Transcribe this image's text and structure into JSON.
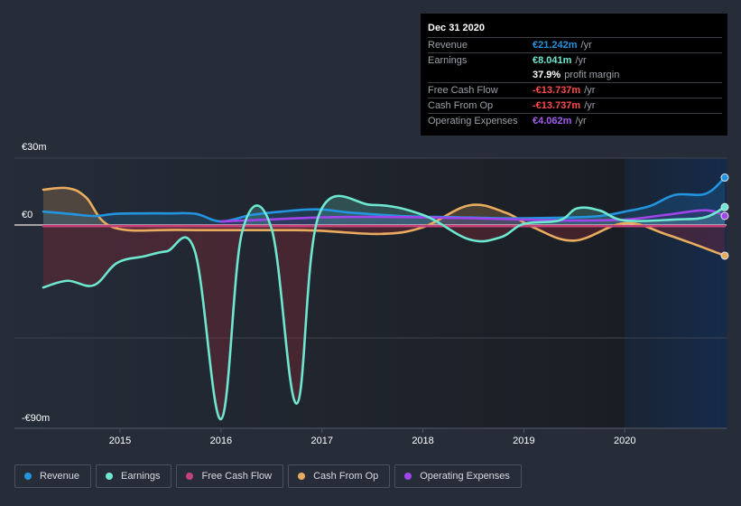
{
  "tooltip": {
    "date": "Dec 31 2020",
    "rows": [
      {
        "label": "Revenue",
        "value": "€21.242m",
        "unit": "/yr",
        "color": "#2394df"
      },
      {
        "label": "Earnings",
        "value": "€8.041m",
        "unit": "/yr",
        "color": "#6ee7d0"
      },
      {
        "label": "",
        "value": "37.9%",
        "unit": "profit margin",
        "color": "#ffffff"
      },
      {
        "label": "Free Cash Flow",
        "value": "-€13.737m",
        "unit": "/yr",
        "color": "#ff4a4a"
      },
      {
        "label": "Cash From Op",
        "value": "-€13.737m",
        "unit": "/yr",
        "color": "#ff4a4a"
      },
      {
        "label": "Operating Expenses",
        "value": "€4.062m",
        "unit": "/yr",
        "color": "#a45ef0"
      }
    ]
  },
  "legend": [
    {
      "label": "Revenue",
      "color": "#2394df"
    },
    {
      "label": "Earnings",
      "color": "#6ee7d0"
    },
    {
      "label": "Free Cash Flow",
      "color": "#c4417a"
    },
    {
      "label": "Cash From Op",
      "color": "#e9ac5f"
    },
    {
      "label": "Operating Expenses",
      "color": "#a045ea"
    }
  ],
  "chart_data": {
    "type": "line",
    "title": "",
    "xlabel": "",
    "ylabel": "",
    "y_tick_labels": [
      "€30m",
      "€0",
      "-€90m"
    ],
    "y_ticks": [
      30,
      0,
      -90
    ],
    "ylim": [
      -91,
      30
    ],
    "xlim": [
      2014.24,
      2020.99
    ],
    "x_ticks": [
      2015,
      2016,
      2017,
      2018,
      2019,
      2020
    ],
    "x_tick_labels": [
      "2015",
      "2016",
      "2017",
      "2018",
      "2019",
      "2020"
    ],
    "highlight_from": 2020.0,
    "grid": true,
    "legend_position": "bottom",
    "series": [
      {
        "name": "Revenue",
        "color": "#2394df",
        "x": [
          2014.24,
          2014.5,
          2014.75,
          2014.95,
          2015.2,
          2015.5,
          2015.75,
          2016.0,
          2016.3,
          2016.6,
          2016.95,
          2017.3,
          2017.8,
          2018.3,
          2018.8,
          2019.3,
          2019.75,
          2020.0,
          2020.25,
          2020.5,
          2020.8,
          2020.99
        ],
        "y": [
          6,
          5,
          4,
          5,
          5.2,
          5.2,
          5.0,
          1.6,
          4.5,
          6.0,
          7.0,
          5.5,
          4.0,
          3.5,
          3.0,
          3.2,
          4.0,
          6.0,
          8.5,
          13.5,
          14.0,
          21.24
        ]
      },
      {
        "name": "Earnings",
        "color": "#6ee7d0",
        "x": [
          2014.24,
          2014.48,
          2014.74,
          2014.97,
          2015.24,
          2015.46,
          2015.74,
          2016.0,
          2016.21,
          2016.5,
          2016.75,
          2016.97,
          2017.5,
          2018.0,
          2018.46,
          2018.77,
          2019.0,
          2019.35,
          2019.53,
          2019.75,
          2020.0,
          2020.52,
          2020.8,
          2020.99
        ],
        "y": [
          -28,
          -25,
          -27,
          -17,
          -14,
          -11.8,
          -11.6,
          -87,
          -3,
          -1.5,
          -80,
          4.5,
          9,
          4.5,
          -6.5,
          -5.5,
          0.5,
          2,
          7.5,
          6.5,
          2,
          2.5,
          3.5,
          8.04
        ]
      },
      {
        "name": "Free Cash Flow",
        "color": "#c4417a",
        "x": [
          2014.24,
          2015.0,
          2016.0,
          2017.0,
          2018.0,
          2019.0,
          2020.0,
          2020.99
        ],
        "y": [
          -0.5,
          -0.5,
          -0.5,
          -0.5,
          -0.5,
          -0.5,
          -0.5,
          -0.5
        ]
      },
      {
        "name": "Cash From Op",
        "color": "#e9ac5f",
        "x": [
          2014.24,
          2014.48,
          2014.66,
          2014.93,
          2015.6,
          2016.5,
          2016.95,
          2017.58,
          2018.0,
          2018.46,
          2018.82,
          2019.1,
          2019.5,
          2020.0,
          2020.43,
          2020.99
        ],
        "y": [
          15.8,
          16.5,
          12.5,
          -1,
          -2.2,
          -2.3,
          -2.5,
          -4,
          -1,
          8.8,
          5.5,
          -1.2,
          -7,
          0.8,
          -4.5,
          -13.74
        ]
      },
      {
        "name": "Operating Expenses",
        "color": "#a045ea",
        "x": [
          2016.0,
          2016.5,
          2017.0,
          2017.5,
          2018.0,
          2018.5,
          2019.0,
          2019.5,
          2020.0,
          2020.4,
          2020.8,
          2020.99
        ],
        "y": [
          1.6,
          2.5,
          3.4,
          3.6,
          3.4,
          3.0,
          2.4,
          2.0,
          2.4,
          4.5,
          6.6,
          4.06
        ]
      }
    ]
  }
}
